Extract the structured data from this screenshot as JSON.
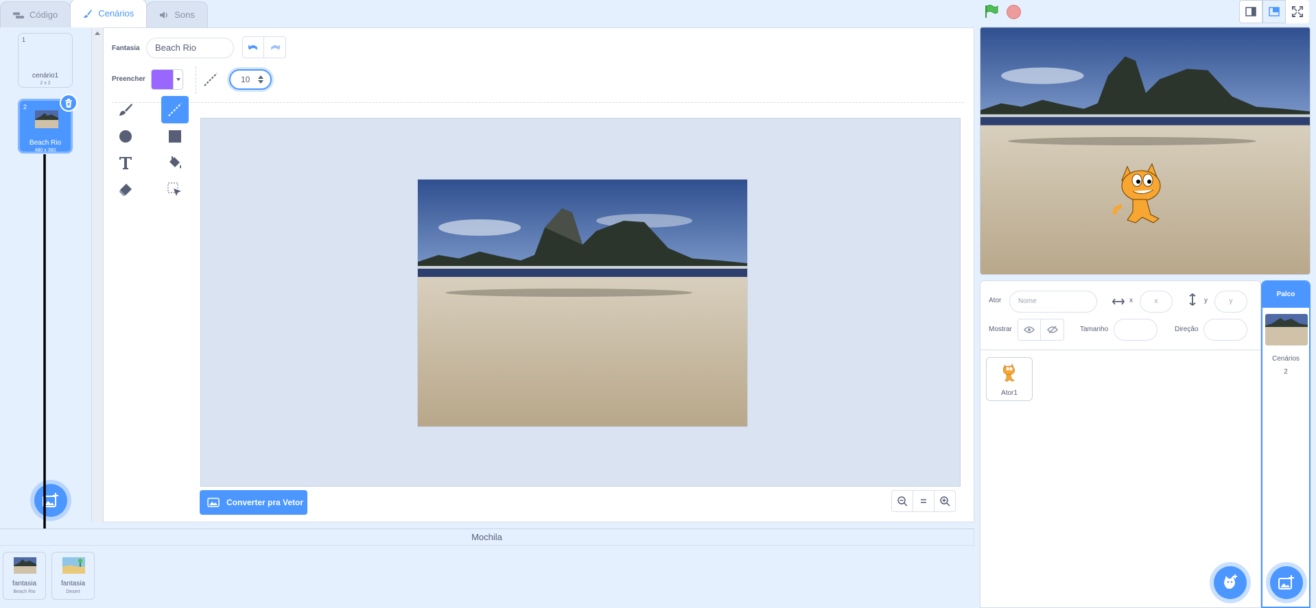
{
  "tabs": [
    {
      "label": "Código",
      "icon": "code-icon"
    },
    {
      "label": "Cenários",
      "icon": "brush-icon"
    },
    {
      "label": "Sons",
      "icon": "speaker-icon"
    }
  ],
  "costumes": [
    {
      "number": "1",
      "name": "cenário1",
      "size": "2 x 2"
    },
    {
      "number": "2",
      "name": "Beach Rio",
      "size": "480 x 360"
    }
  ],
  "editor": {
    "costume_label": "Fantasia",
    "costume_name": "Beach Rio",
    "fill_label": "Preencher",
    "fill_color": "#9966ff",
    "brush_size": "10",
    "convert_button": "Converter pra Vetor",
    "active_tool": "line"
  },
  "backpack": {
    "title": "Mochila",
    "items": [
      {
        "type": "fantasia",
        "name": "Beach Rio"
      },
      {
        "type": "fantasia",
        "name": "Desert"
      }
    ]
  },
  "sprite_info": {
    "sprite_label": "Ator",
    "name_placeholder": "Nome",
    "x_label": "x",
    "x_placeholder": "x",
    "y_label": "y",
    "y_placeholder": "y",
    "show_label": "Mostrar",
    "size_label": "Tamanho",
    "direction_label": "Direção"
  },
  "sprites": [
    {
      "name": "Ator1"
    }
  ],
  "stage_pane": {
    "title": "Palco",
    "backdrops_label": "Cenários",
    "backdrops_count": "2"
  },
  "colors": {
    "accent": "#4c97ff",
    "background": "#e5f0ff"
  }
}
